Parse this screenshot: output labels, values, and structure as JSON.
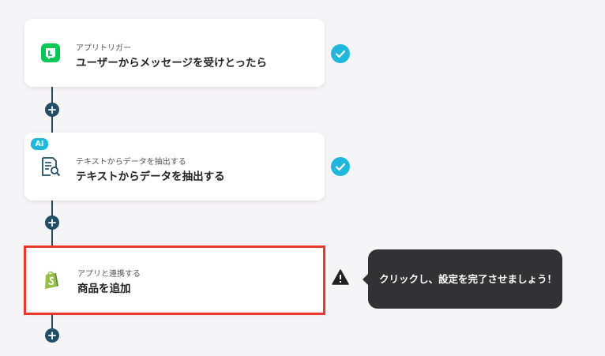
{
  "flow": {
    "steps": [
      {
        "subtitle": "アプリトリガー",
        "title": "ユーザーからメッセージを受けとったら",
        "icon": "line-app-icon",
        "status": "complete"
      },
      {
        "subtitle": "テキストからデータを抽出する",
        "title": "テキストからデータを抽出する",
        "icon": "document-search-icon",
        "badge": "AI",
        "status": "complete"
      },
      {
        "subtitle": "アプリと連携する",
        "title": "商品を追加",
        "icon": "shopify-icon",
        "status": "incomplete"
      }
    ]
  },
  "add_step_icon": "+",
  "tooltip": {
    "text": "クリックし、設定を完了させましょう！"
  },
  "colors": {
    "accent": "#1fb8dc",
    "connector": "#1f4e66",
    "highlight": "#e8392c",
    "line_green": "#06c755",
    "shopify_green": "#95bf47"
  }
}
